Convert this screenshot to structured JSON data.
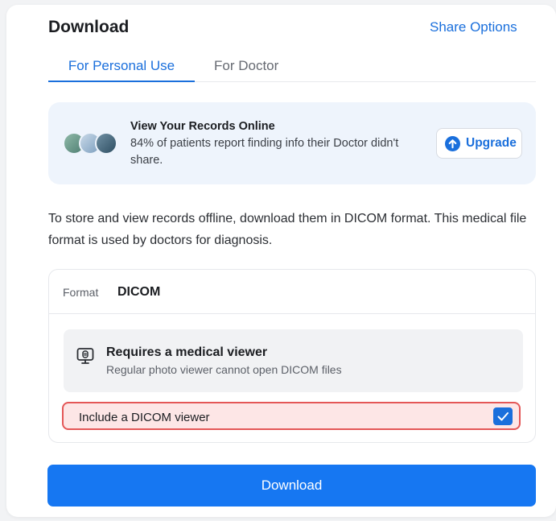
{
  "header": {
    "title": "Download",
    "share_label": "Share Options"
  },
  "tabs": [
    {
      "label": "For Personal Use",
      "active": true
    },
    {
      "label": "For Doctor",
      "active": false
    }
  ],
  "promo": {
    "title": "View Your Records Online",
    "text": "84% of patients report finding info their Doctor didn't share.",
    "upgrade_label": "Upgrade"
  },
  "description": "To store and view records offline, download them in DICOM format. This medical file format is used by doctors for diagnosis.",
  "format": {
    "label": "Format",
    "value": "DICOM",
    "requirement_title": "Requires a medical viewer",
    "requirement_subtitle": "Regular photo viewer cannot open DICOM files",
    "include_viewer_label": "Include a DICOM viewer",
    "include_viewer_checked": true
  },
  "download_label": "Download",
  "colors": {
    "accent": "#1a6fdc",
    "primary_button": "#1677f2",
    "highlight_border": "#e45757",
    "highlight_fill": "#fde6e6"
  }
}
